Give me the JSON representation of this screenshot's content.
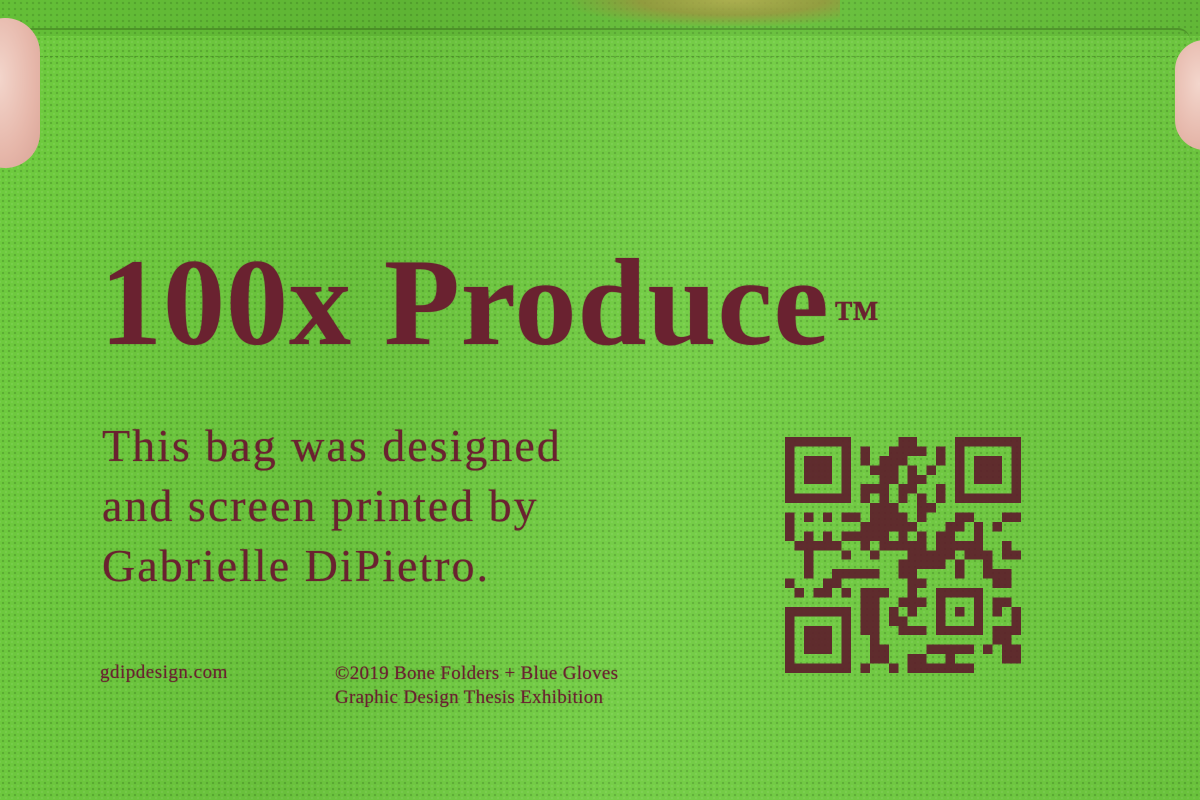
{
  "headline": {
    "text": "100x Produce",
    "trademark": "™"
  },
  "blurb": {
    "lines": [
      "This bag was designed",
      "and screen printed by",
      "Gabrielle DiPietro."
    ]
  },
  "footer": {
    "website": "gdipdesign.com",
    "credit_lines": [
      "©2019 Bone Folders + Blue Gloves",
      "Graphic Design Thesis Exhibition"
    ]
  },
  "colors": {
    "fabric": "#6fcc3f",
    "ink": "#6a2230"
  },
  "icons": {
    "qr": "qr-code-icon"
  }
}
